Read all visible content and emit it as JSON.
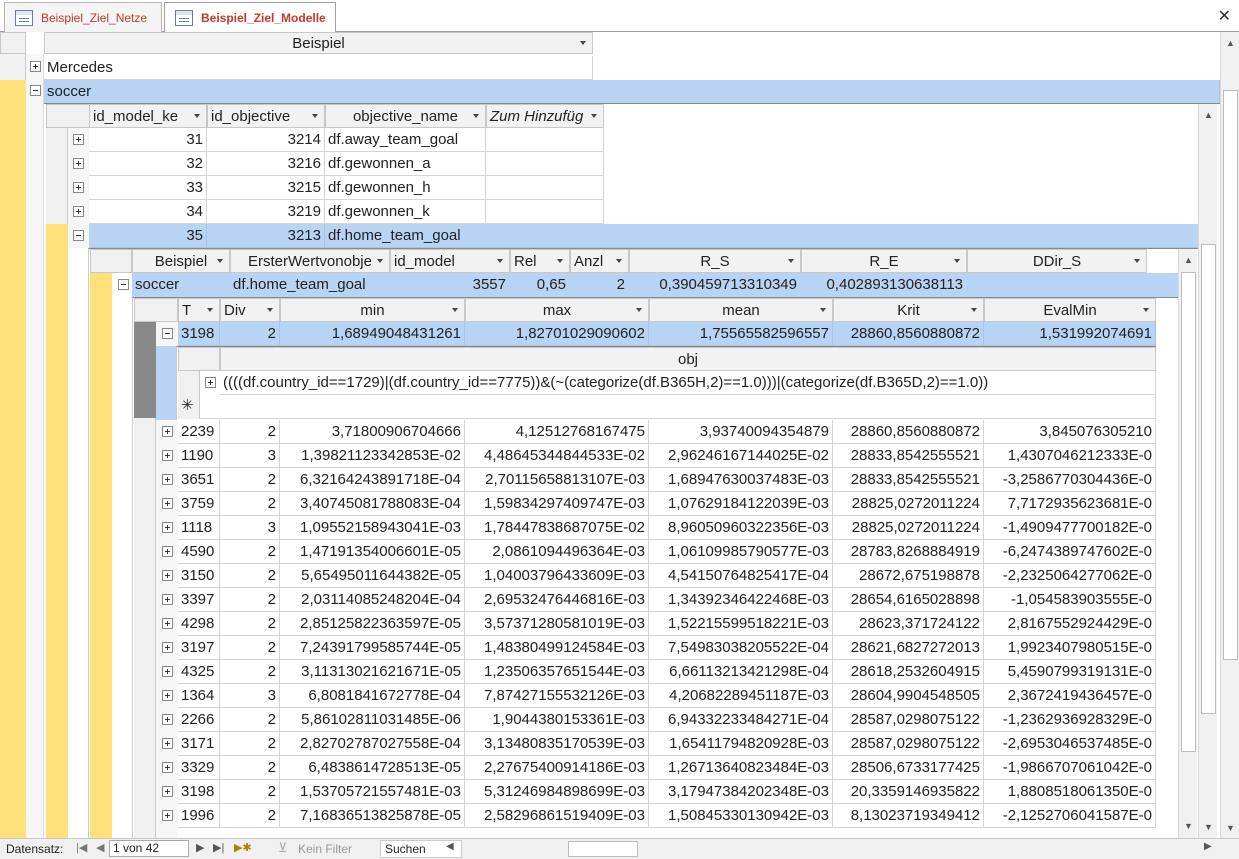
{
  "tabs": [
    {
      "label": "Beispiel_Ziel_Netze"
    },
    {
      "label": "Beispiel_Ziel_Modelle"
    }
  ],
  "close_symbol": "✕",
  "level1": {
    "header": "Beispiel",
    "rows": [
      "Mercedes",
      "soccer"
    ]
  },
  "level2": {
    "headers": [
      "id_model_ke",
      "id_objective",
      "objective_name",
      "Zum Hinzufüg"
    ],
    "rows": [
      [
        "31",
        "3214",
        "df.away_team_goal"
      ],
      [
        "32",
        "3216",
        "df.gewonnen_a"
      ],
      [
        "33",
        "3215",
        "df.gewonnen_h"
      ],
      [
        "34",
        "3219",
        "df.gewonnen_k"
      ],
      [
        "35",
        "3213",
        "df.home_team_goal"
      ]
    ]
  },
  "level3": {
    "headers": [
      "Beispiel",
      "ErsterWertvonobje",
      "id_model",
      "Rel",
      "Anzl",
      "R_S",
      "R_E",
      "DDir_S"
    ],
    "row": [
      "soccer",
      "df.home_team_goal",
      "3557",
      "0,65",
      "2",
      "0,390459713310349",
      "0,402893130638113"
    ]
  },
  "level4": {
    "headers": [
      "T",
      "Div",
      "min",
      "max",
      "mean",
      "Krit",
      "EvalMin"
    ],
    "expanded_row": [
      "3198",
      "2",
      "1,68949048431261",
      "1,82701029090602",
      "1,75565582596557",
      "28860,8560880872",
      "1,531992074691"
    ],
    "rows": [
      [
        "2239",
        "2",
        "3,71800906704666",
        "4,12512768167475",
        "3,93740094354879",
        "28860,8560880872",
        "3,845076305210"
      ],
      [
        "1190",
        "3",
        "1,39821123342853E-02",
        "4,48645344844533E-02",
        "2,96246167144025E-02",
        "28833,8542555521",
        "1,4307046212333E-0"
      ],
      [
        "3651",
        "2",
        "6,32164243891718E-04",
        "2,70115658813107E-03",
        "1,68947630037483E-03",
        "28833,8542555521",
        "-3,2586770304436E-0"
      ],
      [
        "3759",
        "2",
        "3,40745081788083E-04",
        "1,59834297409747E-03",
        "1,07629184122039E-03",
        "28825,0272011224",
        "7,7172935623681E-0"
      ],
      [
        "1118",
        "3",
        "1,09552158943041E-03",
        "1,78447838687075E-02",
        "8,96050960322356E-03",
        "28825,0272011224",
        "-1,4909477700182E-0"
      ],
      [
        "4590",
        "2",
        "1,47191354006601E-05",
        "2,0861094496364E-03",
        "1,06109985790577E-03",
        "28783,8268884919",
        "-6,2474389747602E-0"
      ],
      [
        "3150",
        "2",
        "5,65495011644382E-05",
        "1,04003796433609E-03",
        "4,54150764825417E-04",
        "28672,675198878",
        "-2,2325064277062E-0"
      ],
      [
        "3397",
        "2",
        "2,03114085248204E-04",
        "2,69532476446816E-03",
        "1,34392346422468E-03",
        "28654,6165028898",
        "-1,054583903555E-0"
      ],
      [
        "4298",
        "2",
        "2,85125822363597E-05",
        "3,57371280581019E-03",
        "1,52215599518221E-03",
        "28623,371724122",
        "2,8167552924429E-0"
      ],
      [
        "3197",
        "2",
        "7,24391799585744E-05",
        "1,48380499124584E-03",
        "7,54983038205522E-04",
        "28621,6827272013",
        "1,9923407980515E-0"
      ],
      [
        "4325",
        "2",
        "3,11313021621671E-05",
        "1,23506357651544E-03",
        "6,66113213421298E-04",
        "28618,2532604915",
        "5,4590799319131E-0"
      ],
      [
        "1364",
        "3",
        "6,8081841672778E-04",
        "7,87427155532126E-03",
        "4,20682289451187E-03",
        "28604,9904548505",
        "2,3672419436457E-0"
      ],
      [
        "2266",
        "2",
        "5,86102811031485E-06",
        "1,9044380153361E-03",
        "6,94332233484271E-04",
        "28587,0298075122",
        "-1,2362936928329E-0"
      ],
      [
        "3171",
        "2",
        "2,82702787027558E-04",
        "3,13480835170539E-03",
        "1,65411794820928E-03",
        "28587,0298075122",
        "-2,6953046537485E-0"
      ],
      [
        "3329",
        "2",
        "6,4838614728513E-05",
        "2,27675400914186E-03",
        "1,26713640823484E-03",
        "28506,6733177425",
        "-1,9866707061042E-0"
      ],
      [
        "3198",
        "2",
        "1,53705721557481E-03",
        "5,31246984898699E-03",
        "3,17947384202348E-03",
        "20,3359146935822",
        "1,8808518061350E-0"
      ],
      [
        "1996",
        "2",
        "7,16836513825878E-05",
        "2,58296861519409E-03",
        "1,50845330130942E-03",
        "8,13023719349412",
        "-2,1252706041587E-0"
      ]
    ]
  },
  "level5": {
    "header": "obj",
    "value": "((((df.country_id==1729)|(df.country_id==7775))&(~(categorize(df.B365H,2)==1.0)))|(categorize(df.B365D,2)==1.0))",
    "new_row_symbol": "✳"
  },
  "statusbar": {
    "label": "Datensatz:",
    "record": "1 von 42",
    "filter": "Kein Filter",
    "search": "Suchen"
  }
}
